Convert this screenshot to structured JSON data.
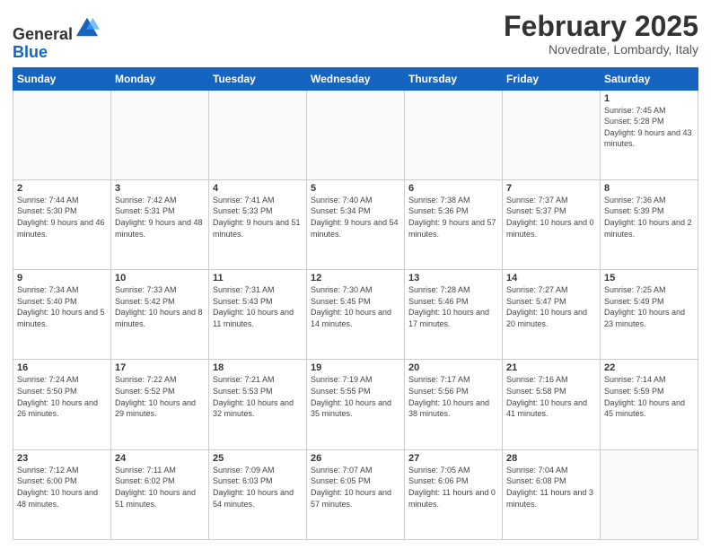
{
  "logo": {
    "general": "General",
    "blue": "Blue"
  },
  "header": {
    "month_year": "February 2025",
    "location": "Novedrate, Lombardy, Italy"
  },
  "weekdays": [
    "Sunday",
    "Monday",
    "Tuesday",
    "Wednesday",
    "Thursday",
    "Friday",
    "Saturday"
  ],
  "weeks": [
    [
      {
        "day": "",
        "info": ""
      },
      {
        "day": "",
        "info": ""
      },
      {
        "day": "",
        "info": ""
      },
      {
        "day": "",
        "info": ""
      },
      {
        "day": "",
        "info": ""
      },
      {
        "day": "",
        "info": ""
      },
      {
        "day": "1",
        "info": "Sunrise: 7:45 AM\nSunset: 5:28 PM\nDaylight: 9 hours and 43 minutes."
      }
    ],
    [
      {
        "day": "2",
        "info": "Sunrise: 7:44 AM\nSunset: 5:30 PM\nDaylight: 9 hours and 46 minutes."
      },
      {
        "day": "3",
        "info": "Sunrise: 7:42 AM\nSunset: 5:31 PM\nDaylight: 9 hours and 48 minutes."
      },
      {
        "day": "4",
        "info": "Sunrise: 7:41 AM\nSunset: 5:33 PM\nDaylight: 9 hours and 51 minutes."
      },
      {
        "day": "5",
        "info": "Sunrise: 7:40 AM\nSunset: 5:34 PM\nDaylight: 9 hours and 54 minutes."
      },
      {
        "day": "6",
        "info": "Sunrise: 7:38 AM\nSunset: 5:36 PM\nDaylight: 9 hours and 57 minutes."
      },
      {
        "day": "7",
        "info": "Sunrise: 7:37 AM\nSunset: 5:37 PM\nDaylight: 10 hours and 0 minutes."
      },
      {
        "day": "8",
        "info": "Sunrise: 7:36 AM\nSunset: 5:39 PM\nDaylight: 10 hours and 2 minutes."
      }
    ],
    [
      {
        "day": "9",
        "info": "Sunrise: 7:34 AM\nSunset: 5:40 PM\nDaylight: 10 hours and 5 minutes."
      },
      {
        "day": "10",
        "info": "Sunrise: 7:33 AM\nSunset: 5:42 PM\nDaylight: 10 hours and 8 minutes."
      },
      {
        "day": "11",
        "info": "Sunrise: 7:31 AM\nSunset: 5:43 PM\nDaylight: 10 hours and 11 minutes."
      },
      {
        "day": "12",
        "info": "Sunrise: 7:30 AM\nSunset: 5:45 PM\nDaylight: 10 hours and 14 minutes."
      },
      {
        "day": "13",
        "info": "Sunrise: 7:28 AM\nSunset: 5:46 PM\nDaylight: 10 hours and 17 minutes."
      },
      {
        "day": "14",
        "info": "Sunrise: 7:27 AM\nSunset: 5:47 PM\nDaylight: 10 hours and 20 minutes."
      },
      {
        "day": "15",
        "info": "Sunrise: 7:25 AM\nSunset: 5:49 PM\nDaylight: 10 hours and 23 minutes."
      }
    ],
    [
      {
        "day": "16",
        "info": "Sunrise: 7:24 AM\nSunset: 5:50 PM\nDaylight: 10 hours and 26 minutes."
      },
      {
        "day": "17",
        "info": "Sunrise: 7:22 AM\nSunset: 5:52 PM\nDaylight: 10 hours and 29 minutes."
      },
      {
        "day": "18",
        "info": "Sunrise: 7:21 AM\nSunset: 5:53 PM\nDaylight: 10 hours and 32 minutes."
      },
      {
        "day": "19",
        "info": "Sunrise: 7:19 AM\nSunset: 5:55 PM\nDaylight: 10 hours and 35 minutes."
      },
      {
        "day": "20",
        "info": "Sunrise: 7:17 AM\nSunset: 5:56 PM\nDaylight: 10 hours and 38 minutes."
      },
      {
        "day": "21",
        "info": "Sunrise: 7:16 AM\nSunset: 5:58 PM\nDaylight: 10 hours and 41 minutes."
      },
      {
        "day": "22",
        "info": "Sunrise: 7:14 AM\nSunset: 5:59 PM\nDaylight: 10 hours and 45 minutes."
      }
    ],
    [
      {
        "day": "23",
        "info": "Sunrise: 7:12 AM\nSunset: 6:00 PM\nDaylight: 10 hours and 48 minutes."
      },
      {
        "day": "24",
        "info": "Sunrise: 7:11 AM\nSunset: 6:02 PM\nDaylight: 10 hours and 51 minutes."
      },
      {
        "day": "25",
        "info": "Sunrise: 7:09 AM\nSunset: 6:03 PM\nDaylight: 10 hours and 54 minutes."
      },
      {
        "day": "26",
        "info": "Sunrise: 7:07 AM\nSunset: 6:05 PM\nDaylight: 10 hours and 57 minutes."
      },
      {
        "day": "27",
        "info": "Sunrise: 7:05 AM\nSunset: 6:06 PM\nDaylight: 11 hours and 0 minutes."
      },
      {
        "day": "28",
        "info": "Sunrise: 7:04 AM\nSunset: 6:08 PM\nDaylight: 11 hours and 3 minutes."
      },
      {
        "day": "",
        "info": ""
      }
    ]
  ]
}
